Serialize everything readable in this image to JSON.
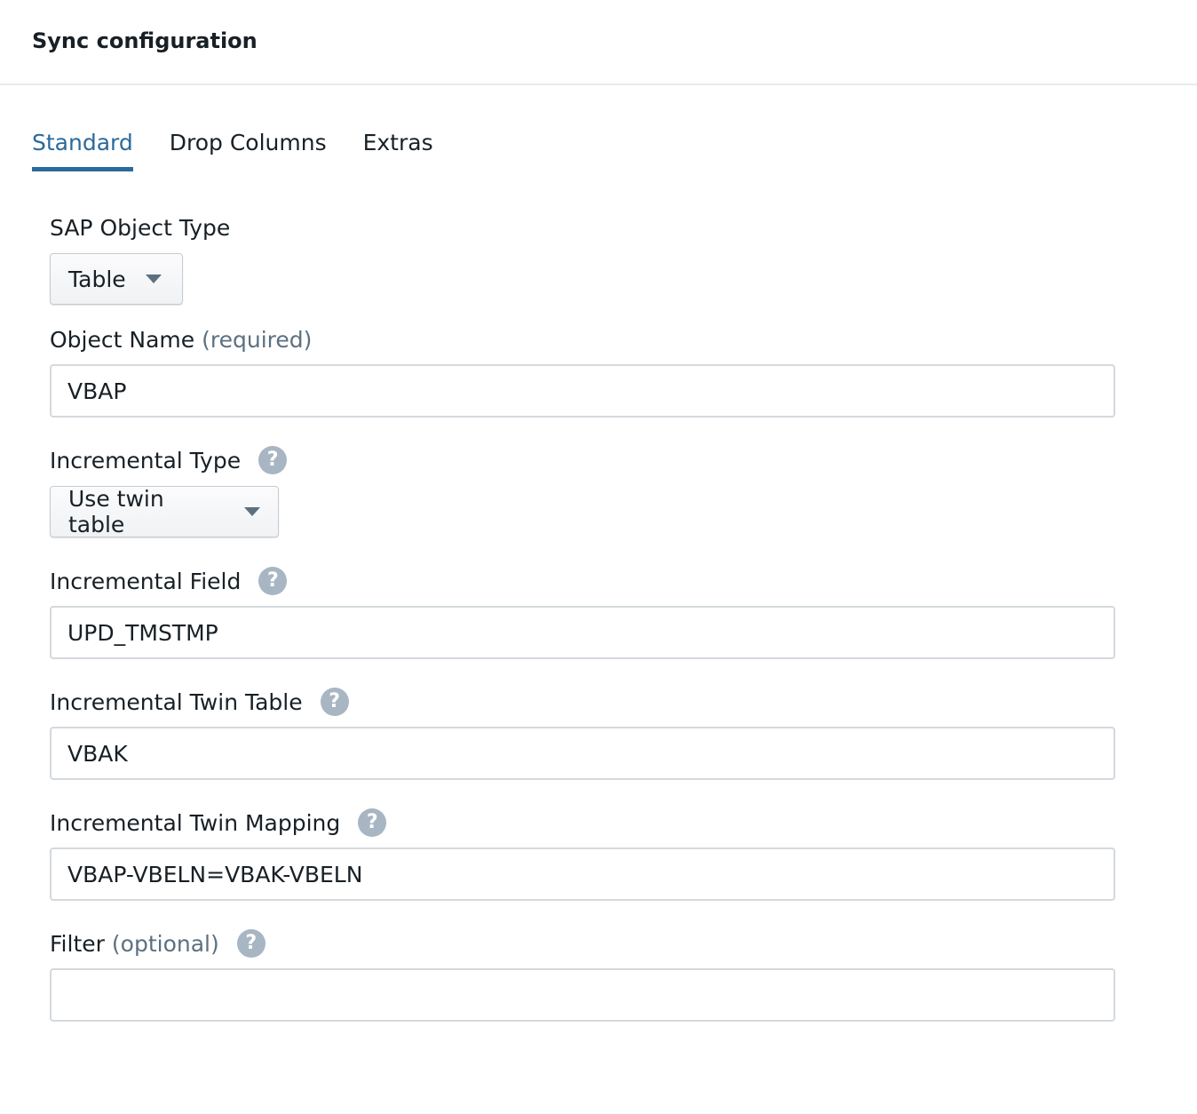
{
  "header": {
    "title": "Sync configuration"
  },
  "tabs": [
    {
      "label": "Standard",
      "active": true
    },
    {
      "label": "Drop Columns",
      "active": false
    },
    {
      "label": "Extras",
      "active": false
    }
  ],
  "form": {
    "sap_object_type": {
      "label": "SAP Object Type",
      "value": "Table"
    },
    "object_name": {
      "label": "Object Name",
      "qualifier": "(required)",
      "value": "VBAP"
    },
    "incremental_type": {
      "label": "Incremental Type",
      "value": "Use twin table",
      "help_icon": "question-circle-icon"
    },
    "incremental_field": {
      "label": "Incremental Field",
      "value": "UPD_TMSTMP",
      "help_icon": "question-circle-icon"
    },
    "incremental_twin_table": {
      "label": "Incremental Twin Table",
      "value": "VBAK",
      "help_icon": "question-circle-icon"
    },
    "incremental_twin_mapping": {
      "label": "Incremental Twin Mapping",
      "value": "VBAP-VBELN=VBAK-VBELN",
      "help_icon": "question-circle-icon"
    },
    "filter": {
      "label": "Filter",
      "qualifier": "(optional)",
      "value": "",
      "help_icon": "question-circle-icon"
    }
  },
  "help_glyph": "?",
  "colors": {
    "accent": "#2b6a9b",
    "muted_text": "#5c7080",
    "help_icon_bg": "#a7b6c2",
    "border": "#d4d9de"
  }
}
